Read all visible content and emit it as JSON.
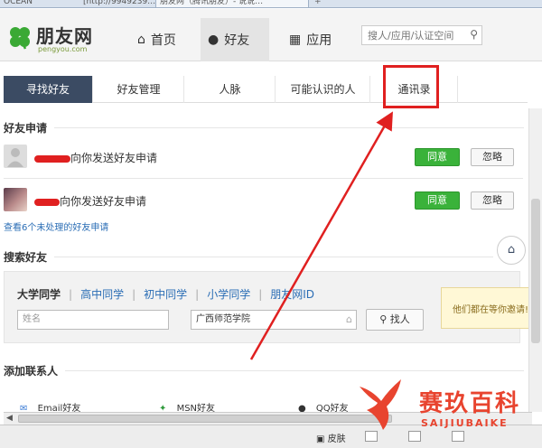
{
  "browser": {
    "tabs": [
      "OCEAN",
      "[http://9949239…",
      "朋友网（腾讯朋友）- 说说…",
      "+"
    ]
  },
  "header": {
    "logo_text": "朋友网",
    "logo_sub": "pengyou.com",
    "nav": [
      {
        "label": "首页",
        "icon": "home-icon"
      },
      {
        "label": "好友",
        "icon": "person-icon"
      },
      {
        "label": "应用",
        "icon": "apps-grid-icon"
      }
    ],
    "search_placeholder": "搜人/应用/认证空间"
  },
  "subtabs": [
    "寻找好友",
    "好友管理",
    "人脉",
    "可能认识的人",
    "通讯录"
  ],
  "friend_requests": {
    "title": "好友申请",
    "items": [
      {
        "text": "向你发送好友申请",
        "accept": "同意",
        "ignore": "忽略"
      },
      {
        "text": "向你发送好友申请",
        "accept": "同意",
        "ignore": "忽略"
      }
    ],
    "more_link": "查看6个未处理的好友申请"
  },
  "search_friends": {
    "title": "搜索好友",
    "school_tabs": [
      "大学同学",
      "高中同学",
      "初中同学",
      "小学同学",
      "朋友网ID"
    ],
    "name_placeholder": "姓名",
    "school_value": "广西师范学院",
    "find_button": "找人"
  },
  "waiting_notice": "他们都在等你邀请!",
  "add_contacts": {
    "title": "添加联系人",
    "items": [
      "Email好友",
      "MSN好友",
      "QQ好友"
    ]
  },
  "statusbar": {
    "skin_label": "皮肤"
  },
  "watermark": {
    "cn": "赛玖百科",
    "en": "SAIJIUBAIKE"
  }
}
